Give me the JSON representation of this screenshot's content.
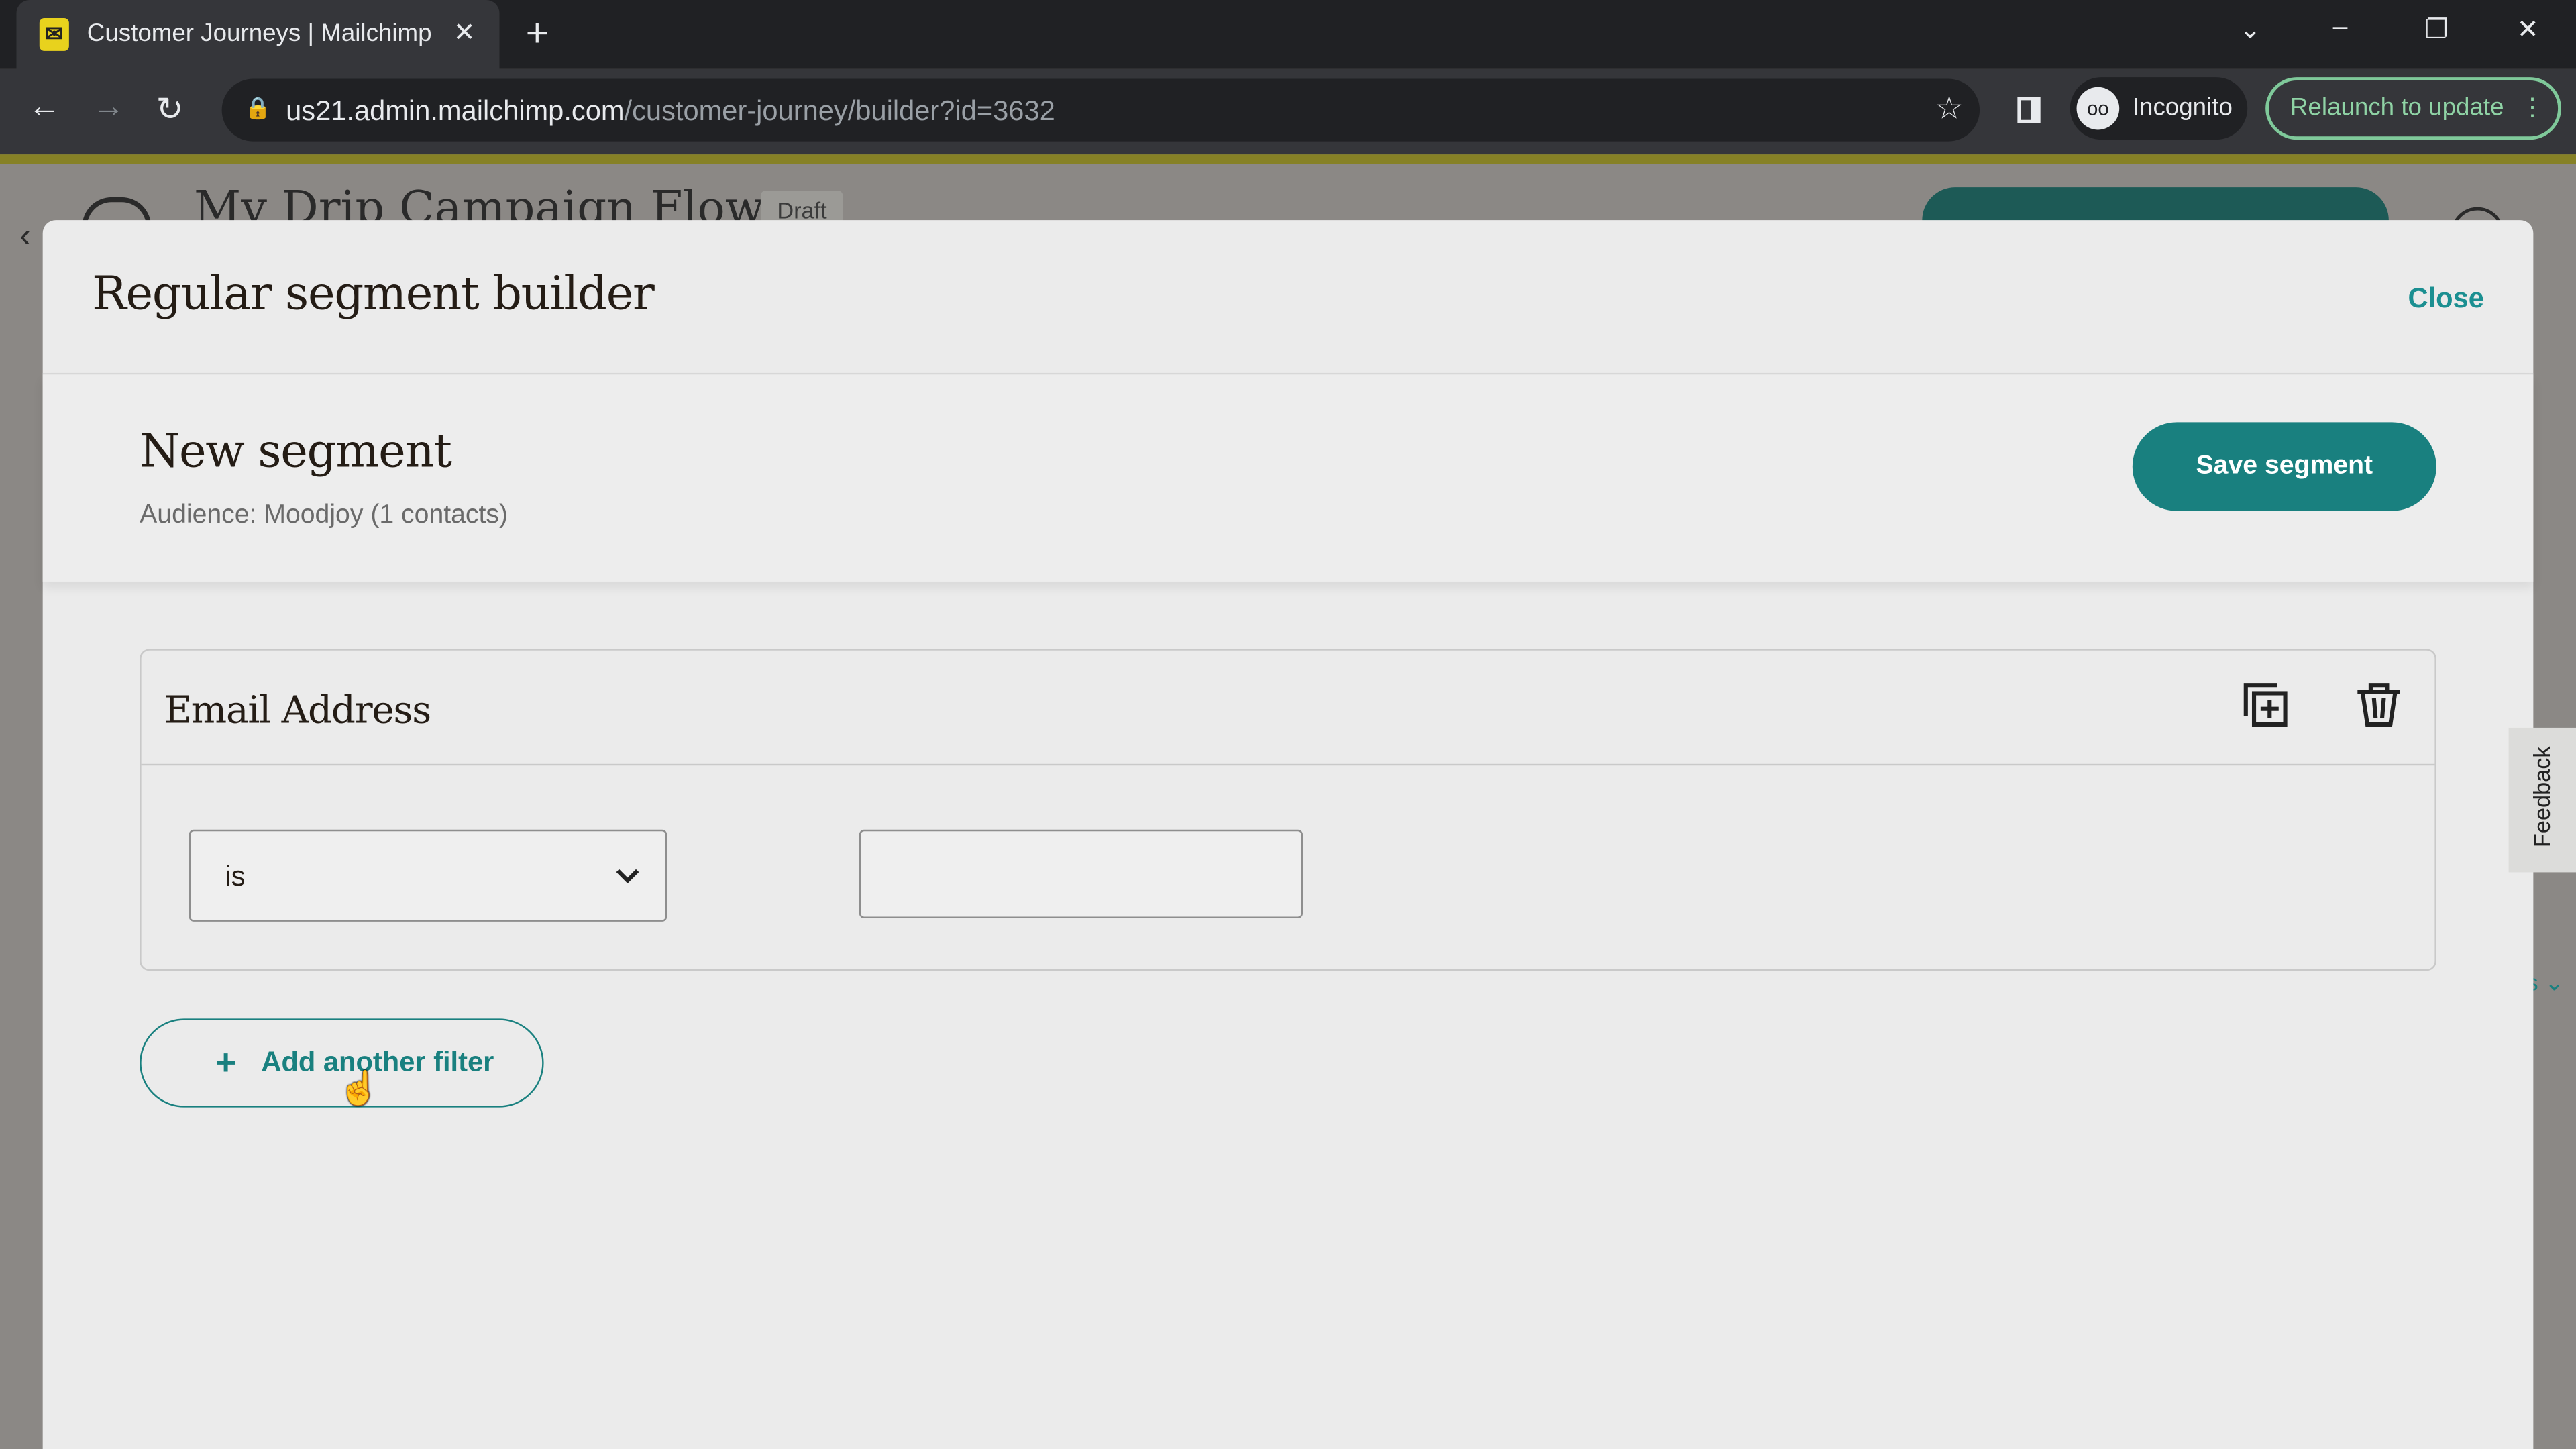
{
  "browser": {
    "tab_title": "Customer Journeys | Mailchimp",
    "favicon": "mailchimp-logo",
    "url_host": "us21.admin.mailchimp.com",
    "url_path": "/customer-journey/builder?id=3632",
    "profile_label": "Incognito",
    "relaunch_label": "Relaunch to update"
  },
  "background_page": {
    "title": "My Drip Campaign Flow",
    "status_badge": "Draft"
  },
  "modal": {
    "title": "Regular segment builder",
    "close_label": "Close",
    "segment_name": "New segment",
    "audience": "Audience: Moodjoy (1 contacts)",
    "save_label": "Save segment",
    "filter": {
      "field": "Email Address",
      "operator": "is",
      "value": ""
    },
    "add_filter_label": "Add another filter"
  },
  "feedback_label": "Feedback",
  "colors": {
    "accent": "#19807f",
    "tab_bar": "#202124",
    "toolbar": "#35363a"
  }
}
